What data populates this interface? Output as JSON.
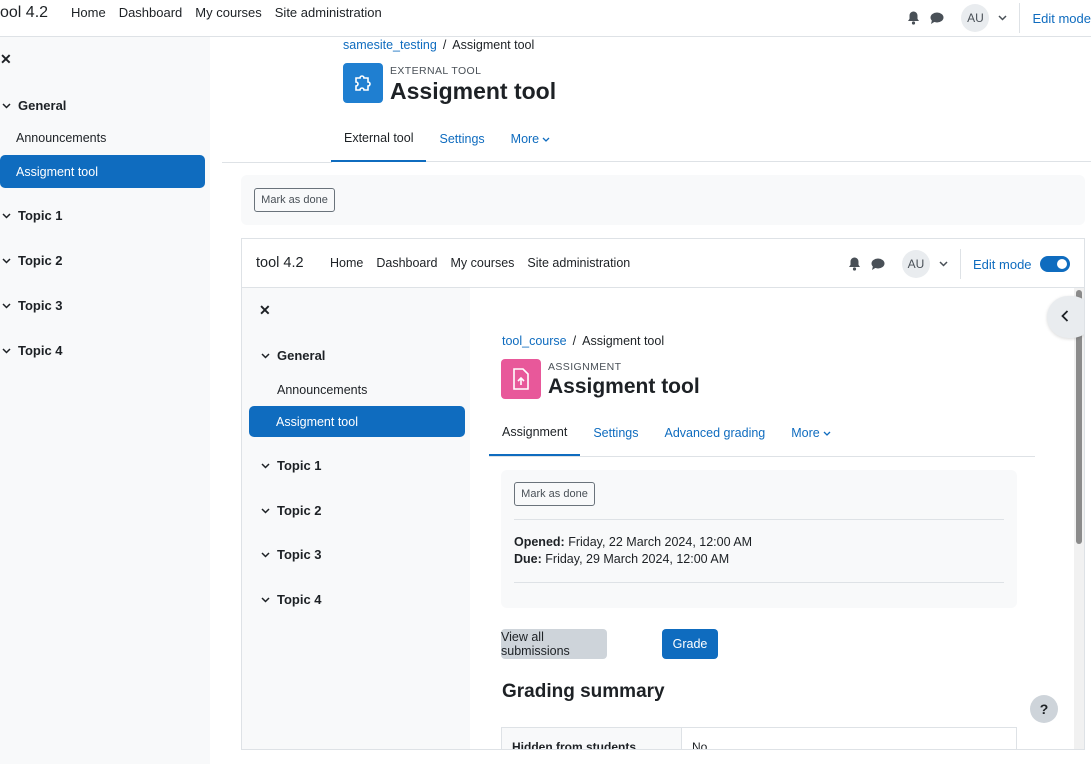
{
  "outer": {
    "navbar": {
      "brand": "ool 4.2",
      "links": [
        "Home",
        "Dashboard",
        "My courses",
        "Site administration"
      ],
      "avatar": "AU",
      "edit_mode": "Edit mode"
    },
    "drawer": {
      "sections": [
        {
          "title": "General",
          "items": [
            {
              "label": "Announcements",
              "active": false
            },
            {
              "label": "Assigment tool",
              "active": true
            }
          ]
        },
        {
          "title": "Topic 1"
        },
        {
          "title": "Topic 2"
        },
        {
          "title": "Topic 3"
        },
        {
          "title": "Topic 4"
        }
      ]
    },
    "breadcrumb": {
      "parent": "samesite_testing",
      "sep": "/",
      "current": "Assigment tool"
    },
    "activity": {
      "type": "External tool",
      "title": "Assigment tool",
      "icon": "puzzle-icon",
      "icon_color": "#1f7fd1"
    },
    "tabs": [
      "External tool",
      "Settings",
      "More"
    ],
    "mark_done": "Mark as done"
  },
  "inner": {
    "navbar": {
      "brand": "tool 4.2",
      "links": [
        "Home",
        "Dashboard",
        "My courses",
        "Site administration"
      ],
      "avatar": "AU",
      "edit_mode": "Edit mode"
    },
    "drawer": {
      "sections": [
        {
          "title": "General",
          "items": [
            {
              "label": "Announcements",
              "active": false
            },
            {
              "label": "Assigment tool",
              "active": true
            }
          ]
        },
        {
          "title": "Topic 1"
        },
        {
          "title": "Topic 2"
        },
        {
          "title": "Topic 3"
        },
        {
          "title": "Topic 4"
        }
      ]
    },
    "breadcrumb": {
      "parent": "tool_course",
      "sep": "/",
      "current": "Assigment tool"
    },
    "activity": {
      "type": "Assignment",
      "title": "Assigment tool",
      "icon": "upload-file-icon",
      "icon_color": "#e8589a"
    },
    "tabs": [
      "Assignment",
      "Settings",
      "Advanced grading",
      "More"
    ],
    "mark_done": "Mark as done",
    "dates": {
      "opened_label": "Opened:",
      "opened_value": "Friday, 22 March 2024, 12:00 AM",
      "due_label": "Due:",
      "due_value": "Friday, 29 March 2024, 12:00 AM"
    },
    "view_all": "View all submissions",
    "grade": "Grade",
    "summary_heading": "Grading summary",
    "summary_row": {
      "label": "Hidden from students",
      "value": "No"
    },
    "help": "?"
  },
  "colors": {
    "primary": "#0f6cbf",
    "drawer_bg": "#f8f9fa"
  }
}
